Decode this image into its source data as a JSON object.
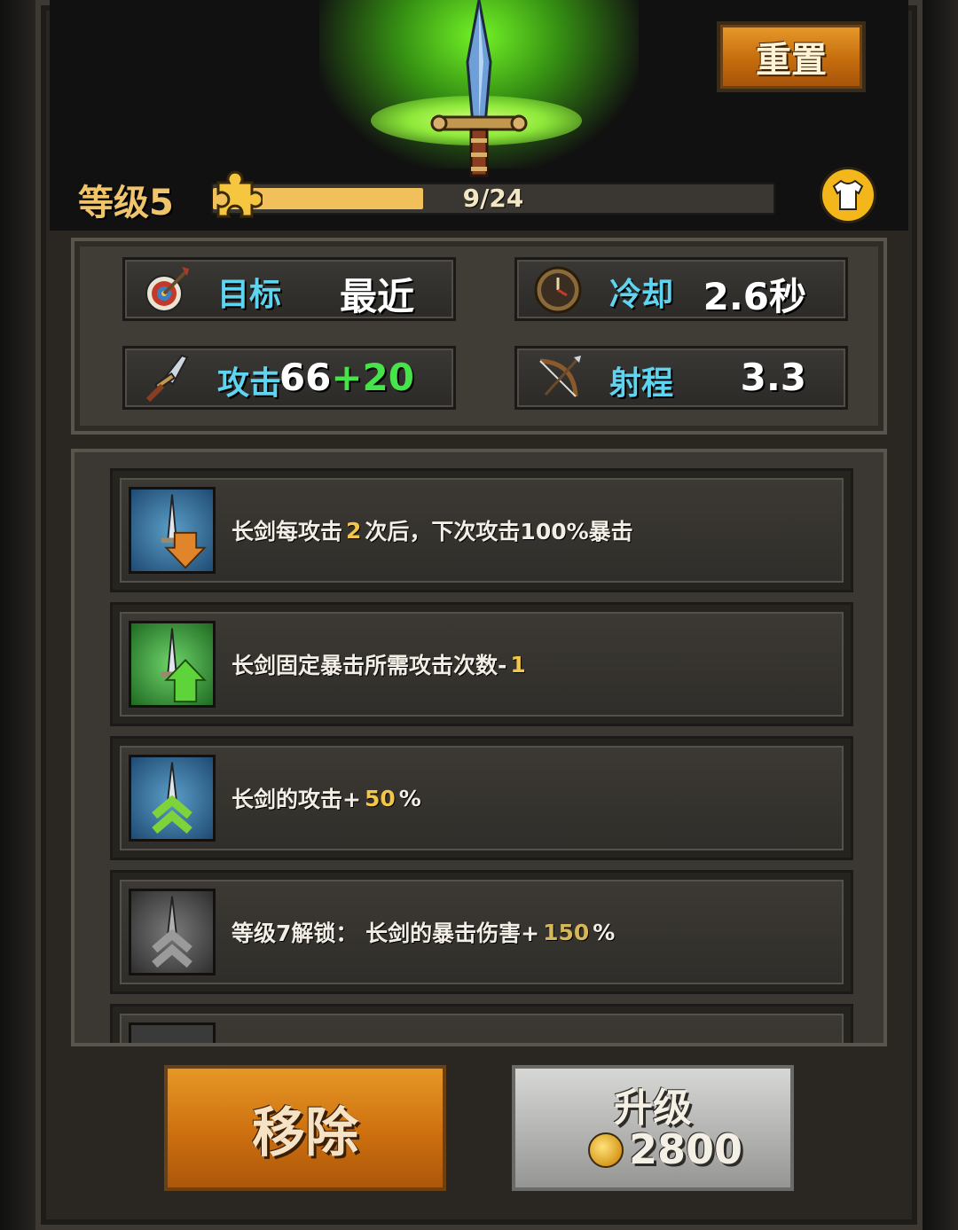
{
  "header": {
    "reset_label": "重置",
    "level_label": "等级5",
    "progress": {
      "text": "9/24",
      "current": 9,
      "total": 24
    }
  },
  "stats": [
    {
      "icon": "target-icon",
      "label": "目标",
      "value": "最近",
      "bonus": ""
    },
    {
      "icon": "cooldown-clock-icon",
      "label": "冷却",
      "value": "2.6秒",
      "bonus": ""
    },
    {
      "icon": "sword-icon",
      "label": "攻击",
      "value": "66",
      "bonus": "+20"
    },
    {
      "icon": "bow-icon",
      "label": "射程",
      "value": "3.3",
      "bonus": ""
    }
  ],
  "skills": [
    {
      "icon": "sword-crit-down-icon",
      "pre": "长剑每攻击",
      "num": "2",
      "post": "次后，下次攻击100%暴击",
      "locked": false
    },
    {
      "icon": "sword-crit-up-icon",
      "pre": "长剑固定暴击所需攻击次数-",
      "num": "1",
      "post": "",
      "locked": false
    },
    {
      "icon": "sword-attack-up-icon",
      "pre": "长剑的攻击+",
      "num": "50",
      "post": "%",
      "locked": false
    },
    {
      "icon": "sword-locked-icon",
      "pre": "等级7解锁：  长剑的暴击伤害+",
      "num": "150",
      "post": "%",
      "locked": true
    }
  ],
  "footer": {
    "remove_label": "移除",
    "upgrade_label": "升级",
    "upgrade_cost": "2800"
  },
  "colors": {
    "accent_orange": "#cd6f0f",
    "stat_label": "#5fd4f0",
    "bonus_green": "#47e34a",
    "highlight_gold": "#f2c64a",
    "glow_green": "#8ee83a"
  }
}
